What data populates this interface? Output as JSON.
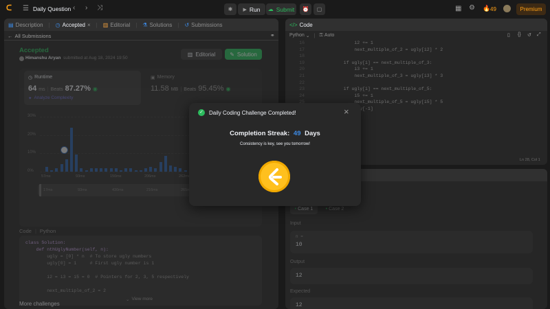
{
  "topbar": {
    "title": "Daily Question",
    "run_label": "Run",
    "submit_label": "Submit",
    "streak_count": "49",
    "premium_label": "Premium"
  },
  "left_tabs": [
    {
      "label": "Description"
    },
    {
      "label": "Accepted"
    },
    {
      "label": "Editorial"
    },
    {
      "label": "Solutions"
    },
    {
      "label": "Submissions"
    }
  ],
  "all_submissions": "All Submissions",
  "submission": {
    "status": "Accepted",
    "author": "Himanshu Aryan",
    "submitted_at": "submitted at Aug 18, 2024 19:50",
    "editorial_btn": "Editorial",
    "solution_btn": "Solution"
  },
  "runtime": {
    "label": "Runtime",
    "value": "64",
    "unit": "ms",
    "beats_label": "Beats",
    "beats": "87.27%",
    "analyze": "Analyze Complexity"
  },
  "memory": {
    "label": "Memory",
    "value": "11.58",
    "unit": "MB",
    "beats_label": "Beats",
    "beats": "95.45%"
  },
  "chart_data": {
    "type": "bar",
    "y_ticks": [
      "30%",
      "20%",
      "10%",
      "0%"
    ],
    "x_ticks": [
      "57ms",
      "93ms",
      "150ms",
      "206ms",
      "262ms",
      "343ms"
    ],
    "brush_ticks": [
      "17ms",
      "93ms",
      "430ms",
      "216ms",
      "265ms",
      "348ms"
    ],
    "ylim": [
      0,
      35
    ],
    "values": [
      3,
      1,
      2,
      5,
      8,
      28,
      11,
      2,
      1,
      2,
      2,
      2,
      2,
      2,
      2,
      1,
      2,
      2,
      1,
      1,
      2,
      3,
      2,
      6,
      10,
      4,
      3,
      2,
      1,
      3,
      2
    ]
  },
  "code_section": {
    "label": "Code",
    "lang": "Python",
    "lines": [
      "class Solution:",
      "    def nthUglyNumber(self, n):",
      "        ugly = [0] * n  # To store ugly numbers",
      "        ugly[0] = 1     # First ugly number is 1",
      "",
      "        i2 = i3 = i5 = 0  # Pointers for 2, 3, 5 respectively",
      "",
      "        next_multiple_of_2 = 2"
    ],
    "view_more": "View more"
  },
  "more_challenges": "More challenges",
  "editor": {
    "title": "Code",
    "lang": "Python",
    "auto": "Auto",
    "line_numbers": [
      "16",
      "17",
      "18",
      "19",
      "20",
      "21",
      "22",
      "23",
      "24",
      "25",
      "26"
    ],
    "lines": [
      "                i2 += 1",
      "                next_multiple_of_2 = ugly[i2] * 2",
      "",
      "            if ugly[i] == next_multiple_of_3:",
      "                i3 += 1",
      "                next_multiple_of_3 = ugly[i3] * 3",
      "",
      "            if ugly[i] == next_multiple_of_5:",
      "                i5 += 1",
      "                next_multiple_of_5 = ugly[i5] * 5",
      "        return ugly[-1]"
    ],
    "cursor_pos": "Ln 28, Col 1"
  },
  "testcase": {
    "case1": "Case 1",
    "case2": "Case 2",
    "input_label": "Input",
    "var_name": "n =",
    "input_value": "10",
    "output_label": "Output",
    "output_value": "12",
    "expected_label": "Expected",
    "expected_value": "12"
  },
  "modal": {
    "title": "Daily Coding Challenge Completed!",
    "streak_prefix": "Completion Streak:",
    "streak_value": "49",
    "streak_suffix": "Days",
    "subtitle": "Consistency is key, see you tomorrow!"
  },
  "colors": {
    "accent_green": "#2cbb5d",
    "accent_blue": "#3d8ce8",
    "coin": "#ffc01e",
    "bar": "#2a5fa8"
  }
}
